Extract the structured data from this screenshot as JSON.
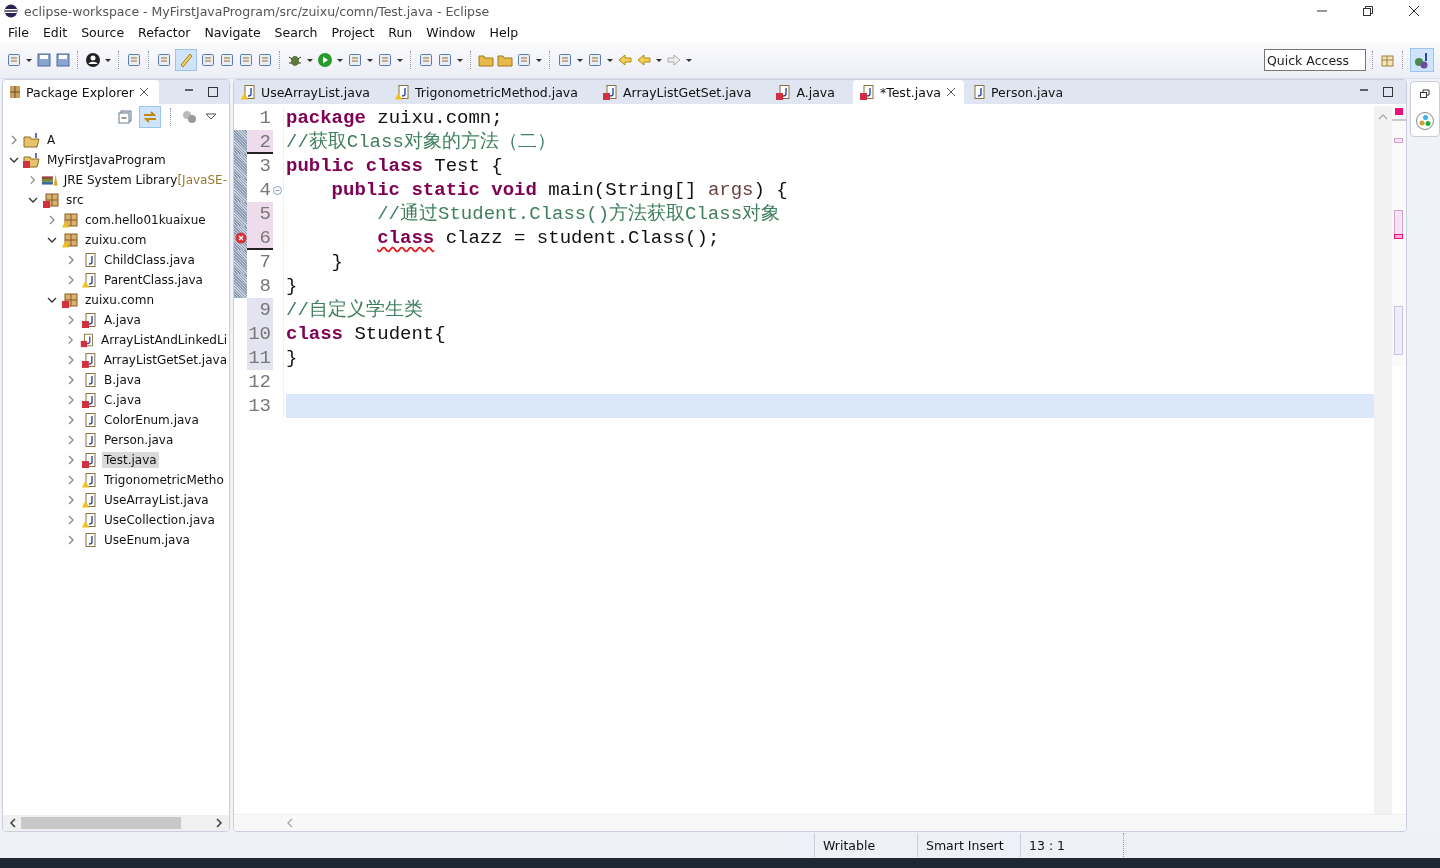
{
  "window": {
    "title": "eclipse-workspace - MyFirstJavaProgram/src/zuixu/comn/Test.java - Eclipse"
  },
  "menu": [
    "File",
    "Edit",
    "Source",
    "Refactor",
    "Navigate",
    "Search",
    "Project",
    "Run",
    "Window",
    "Help"
  ],
  "quick_access": {
    "placeholder": "Quick Access"
  },
  "package_explorer": {
    "title": "Package Explorer",
    "tree": [
      {
        "label": "A",
        "kind": "project",
        "error": false,
        "warning": false,
        "expanded": false,
        "selected": false
      },
      {
        "label": "MyFirstJavaProgram",
        "kind": "project",
        "error": true,
        "warning": false,
        "expanded": true,
        "selected": false,
        "children": [
          {
            "label": "JRE System Library",
            "suffix": "[JavaSE-",
            "kind": "library",
            "error": false,
            "warning": false,
            "expanded": false,
            "selected": false
          },
          {
            "label": "src",
            "kind": "package",
            "error": true,
            "warning": false,
            "expanded": true,
            "selected": false,
            "children": [
              {
                "label": "com.hello01kuaixue",
                "kind": "package",
                "error": false,
                "warning": true,
                "expanded": false,
                "selected": false
              },
              {
                "label": "zuixu.com",
                "kind": "package",
                "error": false,
                "warning": true,
                "expanded": true,
                "selected": false,
                "children": [
                  {
                    "label": "ChildClass.java",
                    "kind": "file",
                    "error": false,
                    "warning": false,
                    "expanded": false,
                    "selected": false
                  },
                  {
                    "label": "ParentClass.java",
                    "kind": "file",
                    "error": false,
                    "warning": true,
                    "expanded": false,
                    "selected": false
                  }
                ]
              },
              {
                "label": "zuixu.comn",
                "kind": "package",
                "error": true,
                "warning": false,
                "expanded": true,
                "selected": false,
                "children": [
                  {
                    "label": "A.java",
                    "kind": "file",
                    "error": true,
                    "warning": false,
                    "expanded": false,
                    "selected": false
                  },
                  {
                    "label": "ArrayListAndLinkedLi",
                    "kind": "file",
                    "error": true,
                    "warning": false,
                    "expanded": false,
                    "selected": false
                  },
                  {
                    "label": "ArrayListGetSet.java",
                    "kind": "file",
                    "error": true,
                    "warning": false,
                    "expanded": false,
                    "selected": false
                  },
                  {
                    "label": "B.java",
                    "kind": "file",
                    "error": false,
                    "warning": false,
                    "expanded": false,
                    "selected": false
                  },
                  {
                    "label": "C.java",
                    "kind": "file",
                    "error": true,
                    "warning": false,
                    "expanded": false,
                    "selected": false
                  },
                  {
                    "label": "ColorEnum.java",
                    "kind": "file",
                    "error": false,
                    "warning": false,
                    "expanded": false,
                    "selected": false
                  },
                  {
                    "label": "Person.java",
                    "kind": "file",
                    "error": false,
                    "warning": false,
                    "expanded": false,
                    "selected": false
                  },
                  {
                    "label": "Test.java",
                    "kind": "file",
                    "error": true,
                    "warning": false,
                    "expanded": false,
                    "selected": true
                  },
                  {
                    "label": "TrigonometricMetho",
                    "kind": "file",
                    "error": false,
                    "warning": true,
                    "expanded": false,
                    "selected": false
                  },
                  {
                    "label": "UseArrayList.java",
                    "kind": "file",
                    "error": false,
                    "warning": true,
                    "expanded": false,
                    "selected": false
                  },
                  {
                    "label": "UseCollection.java",
                    "kind": "file",
                    "error": false,
                    "warning": true,
                    "expanded": false,
                    "selected": false
                  },
                  {
                    "label": "UseEnum.java",
                    "kind": "file",
                    "error": false,
                    "warning": false,
                    "expanded": false,
                    "selected": false
                  }
                ]
              }
            ]
          }
        ]
      }
    ]
  },
  "editor_tabs": [
    {
      "label": "UseArrayList.java",
      "error": false,
      "warning": true,
      "selected": false
    },
    {
      "label": "TrigonometricMethod.java",
      "error": false,
      "warning": true,
      "selected": false
    },
    {
      "label": "ArrayListGetSet.java",
      "error": true,
      "warning": false,
      "selected": false
    },
    {
      "label": "A.java",
      "error": true,
      "warning": false,
      "selected": false
    },
    {
      "label": "*Test.java",
      "error": true,
      "warning": false,
      "selected": true
    },
    {
      "label": "Person.java",
      "error": false,
      "warning": false,
      "selected": false
    }
  ],
  "code_lines": [
    {
      "number": "1",
      "changed": false,
      "added": false,
      "in_range": false,
      "error": false,
      "fold": false,
      "current": false,
      "segments": [
        {
          "kind": "keyword",
          "text": "package"
        },
        {
          "kind": "plain",
          "text": " zuixu.comn;"
        }
      ]
    },
    {
      "number": "2",
      "changed": true,
      "added": false,
      "in_range": true,
      "error": false,
      "fold": false,
      "current": false,
      "segments": [
        {
          "kind": "comment",
          "text": "//获取Class对象的方法（二）"
        }
      ]
    },
    {
      "number": "3",
      "changed": false,
      "added": false,
      "in_range": true,
      "error": false,
      "fold": false,
      "current": false,
      "segments": [
        {
          "kind": "keyword",
          "text": "public class"
        },
        {
          "kind": "plain",
          "text": " Test {"
        }
      ]
    },
    {
      "number": "4",
      "changed": false,
      "added": false,
      "in_range": true,
      "error": false,
      "fold": true,
      "current": false,
      "segments": [
        {
          "kind": "keyword",
          "text": "    public static void"
        },
        {
          "kind": "plain",
          "text": " main(String[] "
        },
        {
          "kind": "param",
          "text": "args"
        },
        {
          "kind": "plain",
          "text": ") {"
        }
      ]
    },
    {
      "number": "5",
      "changed": true,
      "added": false,
      "in_range": true,
      "error": false,
      "fold": false,
      "current": false,
      "segments": [
        {
          "kind": "comment",
          "text": "        //通过Student.Class()方法获取Class对象"
        }
      ]
    },
    {
      "number": "6",
      "changed": true,
      "added": false,
      "in_range": true,
      "error": true,
      "fold": false,
      "current": false,
      "segments": [
        {
          "kind": "error-keyword",
          "text": "        class"
        },
        {
          "kind": "plain",
          "text": " clazz = student.Class();"
        }
      ]
    },
    {
      "number": "7",
      "changed": false,
      "added": false,
      "in_range": true,
      "error": false,
      "fold": false,
      "current": false,
      "segments": [
        {
          "kind": "plain",
          "text": "    }"
        }
      ]
    },
    {
      "number": "8",
      "changed": false,
      "added": false,
      "in_range": true,
      "error": false,
      "fold": false,
      "current": false,
      "segments": [
        {
          "kind": "plain",
          "text": "}"
        }
      ]
    },
    {
      "number": "9",
      "changed": false,
      "added": true,
      "in_range": false,
      "error": false,
      "fold": false,
      "current": false,
      "segments": [
        {
          "kind": "comment",
          "text": "//自定义学生类"
        }
      ]
    },
    {
      "number": "10",
      "changed": false,
      "added": true,
      "in_range": false,
      "error": false,
      "fold": false,
      "current": false,
      "segments": [
        {
          "kind": "keyword",
          "text": "class"
        },
        {
          "kind": "plain",
          "text": " Student{"
        }
      ]
    },
    {
      "number": "11",
      "changed": false,
      "added": true,
      "in_range": false,
      "error": false,
      "fold": false,
      "current": false,
      "segments": [
        {
          "kind": "plain",
          "text": "}"
        }
      ]
    },
    {
      "number": "12",
      "changed": false,
      "added": false,
      "in_range": false,
      "error": false,
      "fold": false,
      "current": false
    },
    {
      "number": "13",
      "changed": false,
      "added": false,
      "in_range": false,
      "error": false,
      "fold": false,
      "current": true
    }
  ],
  "status_bar": [
    "Writable",
    "Smart Insert",
    "13 : 1"
  ]
}
